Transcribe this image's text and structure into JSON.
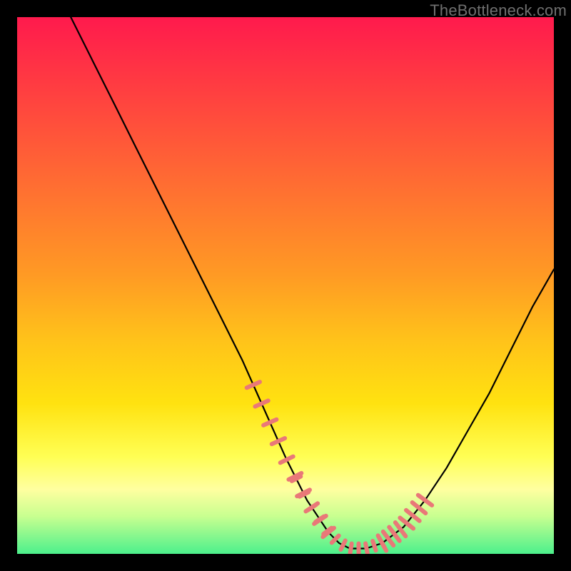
{
  "watermark": "TheBottleneck.com",
  "chart_data": {
    "type": "line",
    "title": "",
    "xlabel": "",
    "ylabel": "",
    "xlim": [
      0,
      100
    ],
    "ylim": [
      0,
      100
    ],
    "grid": false,
    "annotations": "Rainbow gradient background from red (top) to green (bottom); black V-shaped curve; salmon hash marks along lower arms of V",
    "series": [
      {
        "name": "curve",
        "x": [
          10,
          14,
          18,
          22,
          26,
          30,
          34,
          38,
          42,
          46,
          50,
          54,
          58,
          60,
          62,
          65,
          68,
          72,
          76,
          80,
          84,
          88,
          92,
          96,
          100
        ],
        "y": [
          100,
          92,
          84,
          76,
          68,
          60,
          52,
          44,
          36,
          27,
          18,
          10,
          4,
          2,
          1,
          1,
          2,
          5,
          10,
          16,
          23,
          30,
          38,
          46,
          53
        ]
      }
    ],
    "hash_marks": {
      "color": "#e97878",
      "left_arm": {
        "x_start": 44,
        "x_end": 58,
        "count": 10
      },
      "valley": {
        "x_start": 52,
        "x_end": 68,
        "count": 12
      },
      "right_arm": {
        "x_start": 68,
        "x_end": 76,
        "count": 8
      }
    }
  }
}
